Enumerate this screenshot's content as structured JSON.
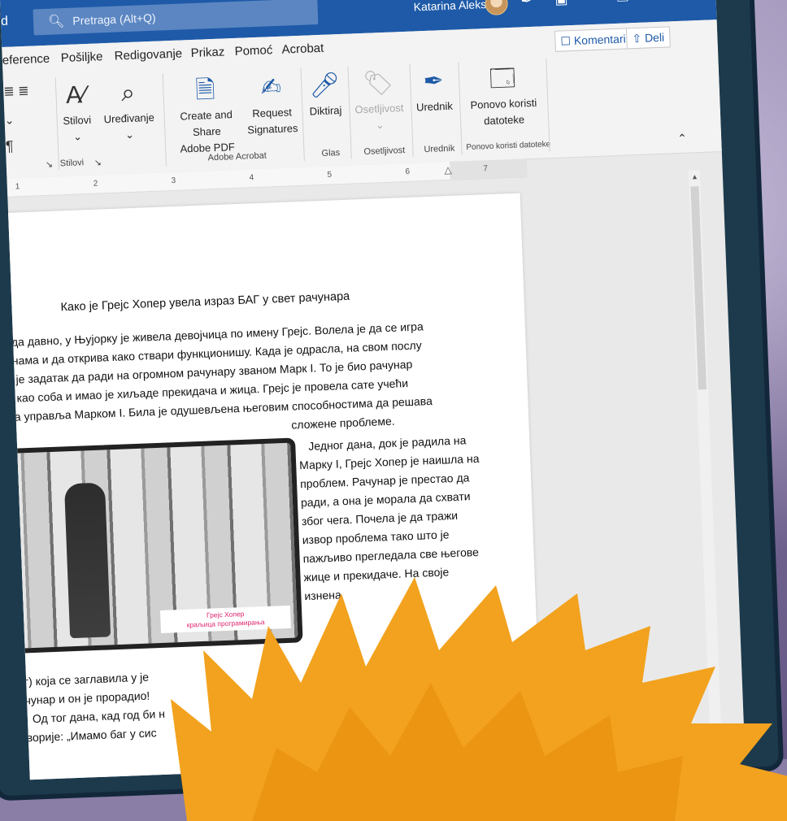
{
  "titlebar": {
    "doc_fragment": "d",
    "search_placeholder": "Pretraga (Alt+Q)",
    "user_name": "Katarina Aleksić"
  },
  "menu": {
    "items": [
      "eference",
      "Pošiljke",
      "Redigovanje",
      "Prikaz",
      "Pomoć",
      "Acrobat"
    ],
    "komentari": "Komentari",
    "deli": "Deli"
  },
  "ribbon": {
    "stilovi": "Stilovi",
    "uredjivanje": "Uređivanje",
    "create_share_1": "Create and Share",
    "create_share_2": "Adobe PDF",
    "request_1": "Request",
    "request_2": "Signatures",
    "diktiraj": "Diktiraj",
    "osetljivost": "Osetljivost",
    "urednik": "Urednik",
    "ponovo_1": "Ponovo koristi",
    "ponovo_2": "datoteke",
    "groups": {
      "stilovi": "Stilovi",
      "adobe": "Adobe Acrobat",
      "glas": "Glas",
      "osetljivost": "Osetljivost",
      "urednik": "Urednik",
      "ponovo": "Ponovo koristi datoteke"
    }
  },
  "ruler": {
    "marks": [
      "1",
      "2",
      "3",
      "4",
      "5",
      "6",
      "7"
    ]
  },
  "document": {
    "title": "Како је Грејс Хопер увела израз БАГ у свет рачунара",
    "para1": [
      "ада давно, у Њујорку је живела девојчица по имену Грејс. Волела је да се игра",
      "инама и да открива како ствари функционишу. Када је одрасла, на свом послу",
      "а је задатак да ради на огромном рачунару званом Марк I. То је био рачунар",
      "и као соба и имао је хиљаде прекидача и жица. Грејс је провела сате учећи",
      "да управља Марком I. Била је одушевљена његовим способностима да решава"
    ],
    "para1_end": "сложене проблеме.",
    "para2": [
      "Једног дана, док је радила на",
      "Марку I, Грејс Хопер је наишла на",
      "проблем. Рачунар је престао да",
      "ради, а она је морала да схвати",
      "због чега. Почела је да тражи",
      "извор проблема тако што је",
      "пажљиво прегледала све његове",
      "жице и прекидаче. На своје",
      "изнена"
    ],
    "para3": [
      "аг) која се заглавила у је",
      "ачунар и он је прорадио!",
      "Од тог дана, кад год би н",
      "оворије: „Имамо баг у сис"
    ],
    "photo_caption_1": "Грејс Хопер",
    "photo_caption_2": "краљица програмирања"
  },
  "colors": {
    "titlebar": "#1e5aa8",
    "accent": "#1e5aa8",
    "hair": "#f2a21e"
  }
}
